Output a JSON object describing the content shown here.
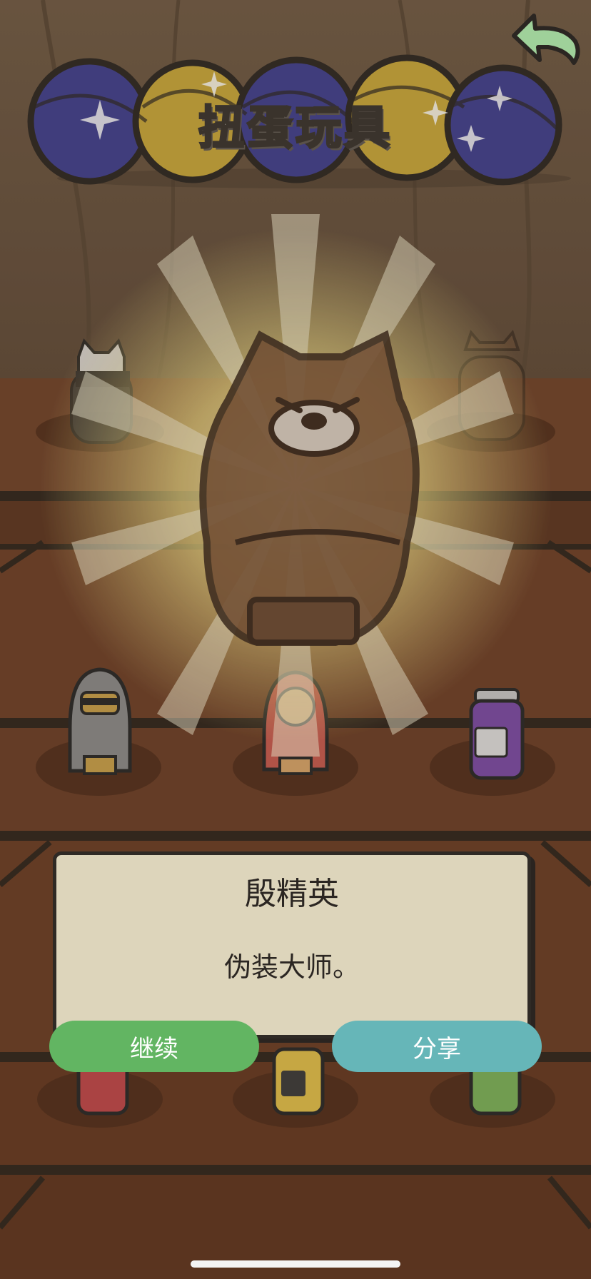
{
  "screen": {
    "title": "扭蛋玩具"
  },
  "icons": {
    "back": "back-arrow-icon",
    "eggs": [
      "capsule-egg-icon",
      "sparkle-icon"
    ]
  },
  "featured_item": {
    "name": "殷精英",
    "description": "伪装大师。"
  },
  "actions": {
    "continue_label": "继续",
    "share_label": "分享"
  },
  "colors": {
    "continue": "#62b562",
    "share": "#66b6b8",
    "card": "#ddd5bb",
    "egg_blue": "#3f3f8f",
    "egg_yellow": "#c9a83a",
    "wood": "#7a4a2c"
  }
}
